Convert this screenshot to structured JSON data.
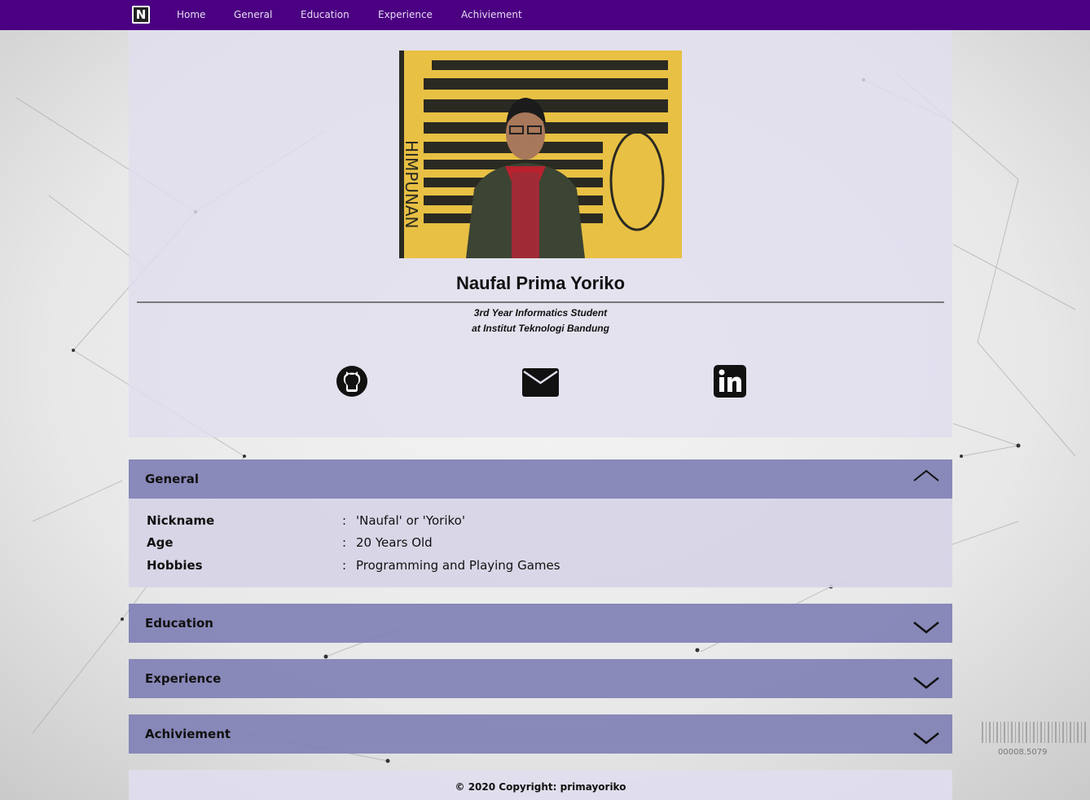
{
  "navbar": {
    "items": [
      {
        "label": "Home"
      },
      {
        "label": "General"
      },
      {
        "label": "Education"
      },
      {
        "label": "Experience"
      },
      {
        "label": "Achiviement"
      }
    ]
  },
  "profile": {
    "name": "Naufal Prima Yoriko",
    "subtitle_line1": "3rd Year Informatics Student",
    "subtitle_line2": "at Institut Teknologi Bandung",
    "photo_banner_text": "HIMPUNAN MAHASISWA INFORMATIKA BANDUNG",
    "social": [
      {
        "icon": "github-icon"
      },
      {
        "icon": "envelope-icon"
      },
      {
        "icon": "linkedin-icon"
      }
    ]
  },
  "sections": {
    "general": {
      "title": "General",
      "expanded": true,
      "rows": [
        {
          "label": "Nickname",
          "sep": ":",
          "value": "'Naufal' or 'Yoriko'"
        },
        {
          "label": "Age",
          "sep": ":",
          "value": "20 Years Old"
        },
        {
          "label": "Hobbies",
          "sep": ":",
          "value": "Programming and Playing Games"
        }
      ]
    },
    "education": {
      "title": "Education",
      "expanded": false
    },
    "experience": {
      "title": "Experience",
      "expanded": false
    },
    "achievement": {
      "title": "Achiviement",
      "expanded": false
    }
  },
  "background": {
    "number_readout": "00008.5079"
  },
  "footer": {
    "copyright": "© 2020 Copyright: primayoriko"
  },
  "colors": {
    "navbar": "#4b0082",
    "section_header": "#8080b5",
    "panel": "#e0deee"
  }
}
